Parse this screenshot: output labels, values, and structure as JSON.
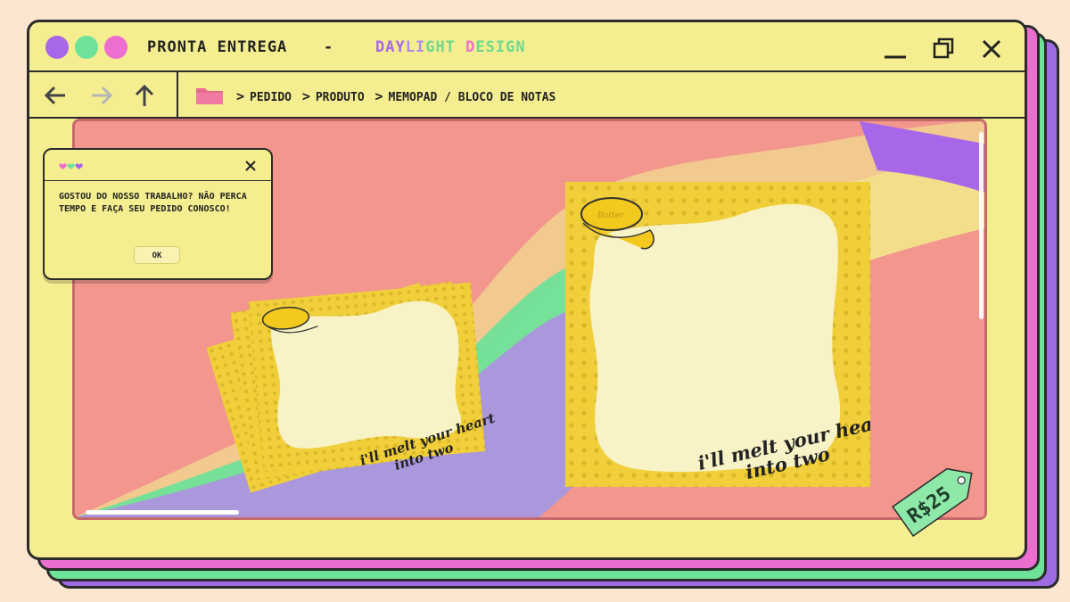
{
  "window": {
    "title": "PRONTA ENTREGA",
    "dash": "-",
    "brand_parts": [
      {
        "text": "DAY",
        "color": "#a866e8"
      },
      {
        "text": "LI",
        "color": "#b08ee6"
      },
      {
        "text": "GHT ",
        "color": "#6fd88f"
      },
      {
        "text": "D",
        "color": "#ec6fcf"
      },
      {
        "text": "ESIGN",
        "color": "#6fd88f"
      }
    ],
    "controls": [
      "minimize-icon",
      "maximize-icon",
      "close-icon"
    ]
  },
  "nav": {
    "breadcrumb": [
      "PEDIDO",
      "PRODUTO",
      "MEMOPAD / BLOCO DE NOTAS"
    ],
    "breadcrumb_separator": ">"
  },
  "popup": {
    "message": "GOSTOU DO NOSSO TRABALHO? NÃO PERCA TEMPO E FAÇA SEU PEDIDO CONOSCO!",
    "ok_label": "OK",
    "heart_colors": [
      "#ec6fcf",
      "#6fe29a",
      "#a866e8"
    ]
  },
  "product": {
    "pad_text_line1": "i'll melt your heart",
    "pad_text_line2": "into two",
    "butter_label": "Butter",
    "price": "R$25"
  },
  "colors": {
    "background": "#fde6cf",
    "window": "#f5ee90",
    "content": "#f3968e",
    "pad_yellow": "#f0cf3a",
    "pad_cream": "#f8f2c7",
    "tag": "#8ee8a8"
  }
}
